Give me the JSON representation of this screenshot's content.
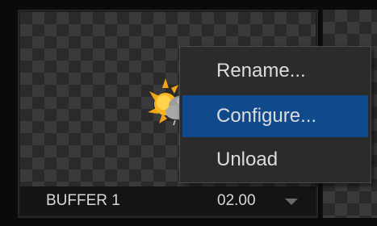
{
  "tile": {
    "name": "BUFFER 1",
    "duration": "02.00"
  },
  "context_menu": {
    "items": [
      {
        "label": "Rename..."
      },
      {
        "label": "Configure...",
        "highlighted": true
      },
      {
        "label": "Unload"
      }
    ]
  },
  "colors": {
    "highlight": "#104a8c",
    "menu_bg": "#2b2b2b",
    "text": "#dcdcdc"
  },
  "icons": {
    "preview_thumbnail": "sun-cloud-icon",
    "dropdown": "caret-down-icon"
  }
}
